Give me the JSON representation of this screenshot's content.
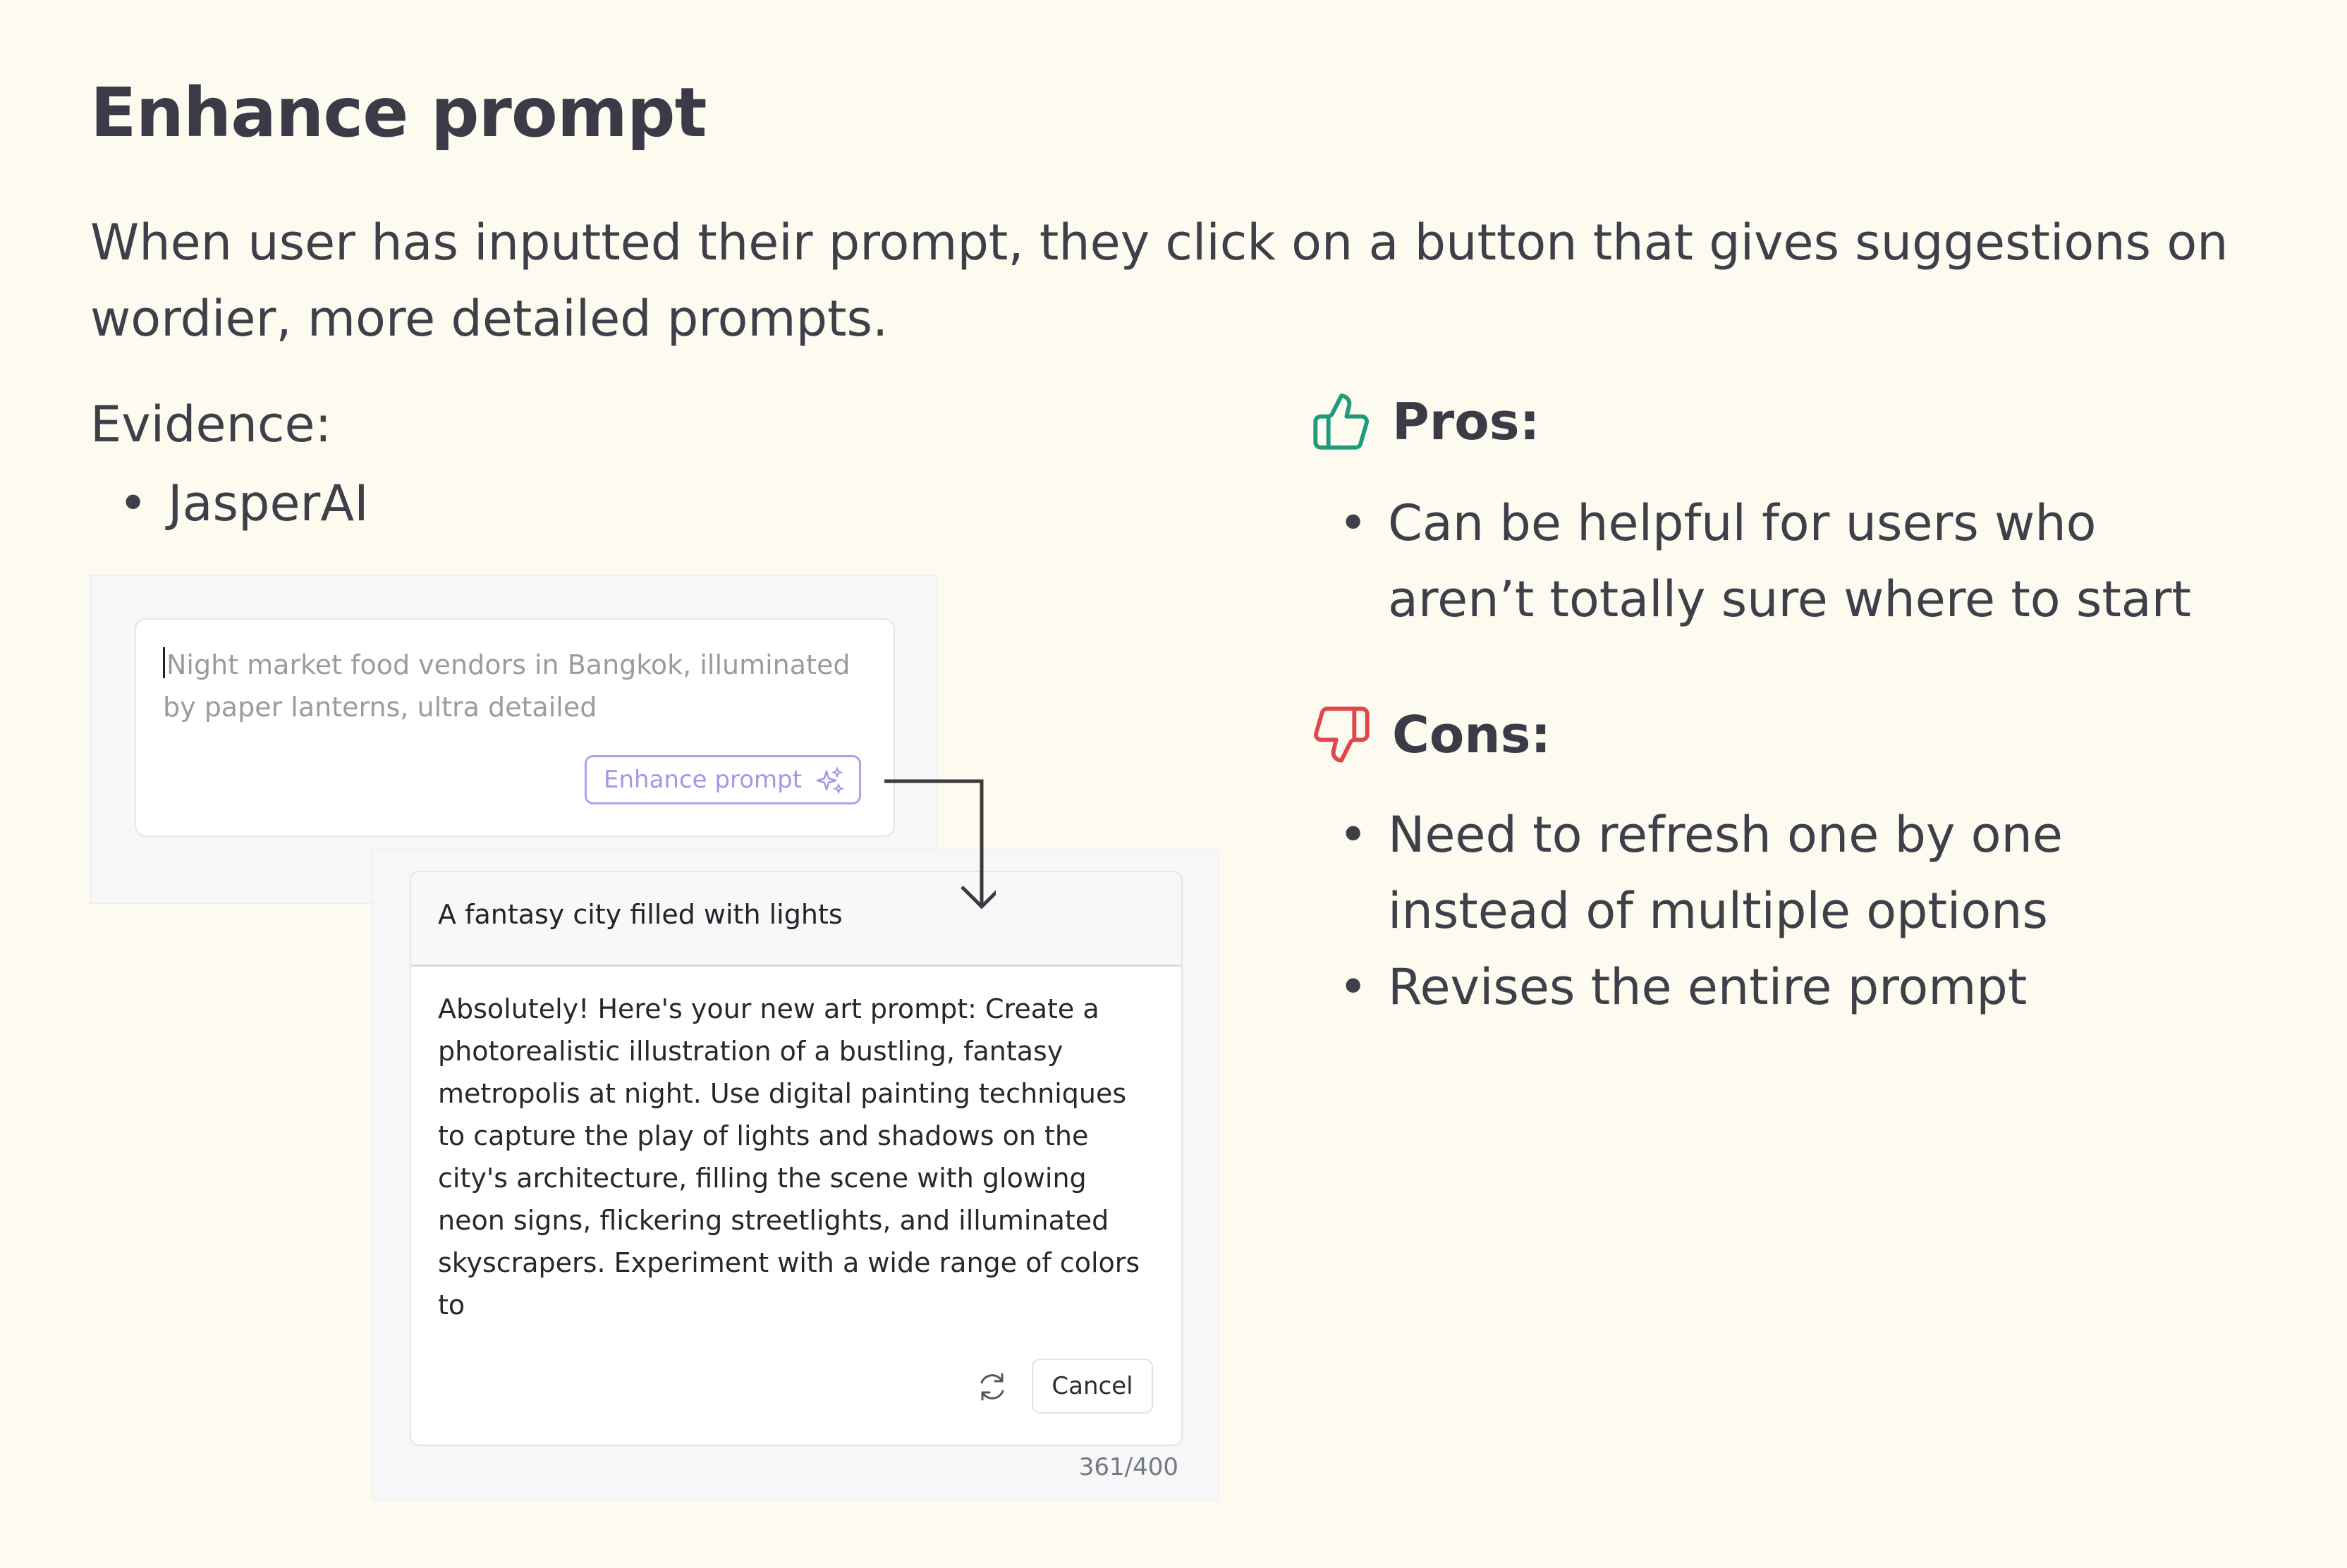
{
  "title": "Enhance prompt",
  "description": "When user has inputted their prompt, they click on a button that gives suggestions on wordier, more detailed prompts.",
  "evidence": {
    "label": "Evidence:",
    "items": [
      "JasperAI"
    ]
  },
  "mockup_input": {
    "prompt_text": "Night market food vendors in Bangkok, illuminated by paper lanterns, ultra detailed",
    "enhance_button_label": "Enhance prompt"
  },
  "mockup_result": {
    "header": "A fantasy city filled with lights",
    "body": "Absolutely! Here's your new art prompt: Create a photorealistic illustration of a bustling, fantasy metropolis at night. Use digital painting techniques to capture the play of lights and shadows on the city's architecture, filling the scene with glowing neon signs, flickering streetlights, and illuminated skyscrapers. Experiment with a wide range of colors to",
    "cancel_label": "Cancel",
    "char_count": "361/400"
  },
  "pros": {
    "label": "Pros:",
    "items": [
      "Can be helpful for users who aren’t totally sure where to start"
    ]
  },
  "cons": {
    "label": "Cons:",
    "items": [
      "Need to refresh one by one instead of multiple options",
      "Revises the entire prompt"
    ]
  },
  "colors": {
    "background": "#fdfaf0",
    "pros_icon": "#1f9a7a",
    "cons_icon": "#e0474c",
    "enhance_accent": "#b59cf0"
  },
  "icons": {
    "pros": "thumbs-up-icon",
    "cons": "thumbs-down-icon",
    "enhance": "sparkle-icon",
    "refresh": "refresh-icon"
  }
}
